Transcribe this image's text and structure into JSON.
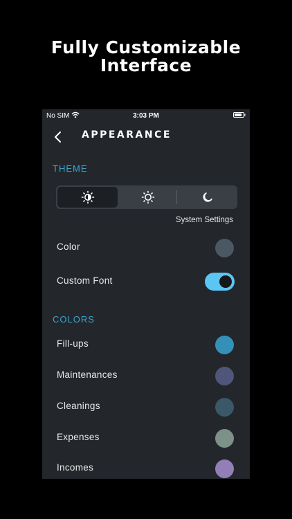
{
  "headline": {
    "line1": "Fully Customizable",
    "line2": "Interface"
  },
  "status_bar": {
    "carrier": "No SIM",
    "time": "3:03 PM"
  },
  "nav": {
    "title": "APPEARANCE"
  },
  "theme": {
    "label": "THEME",
    "options": [
      "auto-theme-icon",
      "sun-icon",
      "moon-icon"
    ],
    "selected_index": 0,
    "caption": "System Settings"
  },
  "settings": {
    "color_label": "Color",
    "color_value": "#4a5863",
    "custom_font_label": "Custom Font",
    "custom_font_on": true
  },
  "colors": {
    "label": "COLORS",
    "items": [
      {
        "label": "Fill-ups",
        "color": "#3590b8"
      },
      {
        "label": "Maintenances",
        "color": "#50557a"
      },
      {
        "label": "Cleanings",
        "color": "#3a5868"
      },
      {
        "label": "Expenses",
        "color": "#7c9189"
      },
      {
        "label": "Incomes",
        "color": "#937fb8"
      }
    ]
  }
}
